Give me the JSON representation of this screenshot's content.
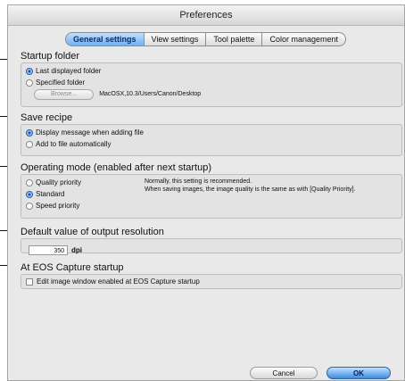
{
  "window": {
    "title": "Preferences"
  },
  "tabs": [
    {
      "label": "General settings"
    },
    {
      "label": "View settings"
    },
    {
      "label": "Tool palette"
    },
    {
      "label": "Color management"
    }
  ],
  "startup_folder": {
    "heading": "Startup folder",
    "options": [
      {
        "label": "Last displayed folder",
        "selected": true
      },
      {
        "label": "Specified folder",
        "selected": false
      }
    ],
    "browse_label": "Browse...",
    "path": "MacOSX,10.3/Users/Canon/Desktop"
  },
  "save_recipe": {
    "heading": "Save recipe",
    "options": [
      {
        "label": "Display message when adding file",
        "selected": true
      },
      {
        "label": "Add to file automatically",
        "selected": false
      }
    ]
  },
  "operating_mode": {
    "heading": "Operating mode (enabled after next startup)",
    "options": [
      {
        "label": "Quality priority",
        "selected": false
      },
      {
        "label": "Standard",
        "selected": true
      },
      {
        "label": "Speed priority",
        "selected": false
      }
    ],
    "note_line1": "Normally, this setting is recommended.",
    "note_line2": "When saving images, the image quality is the same as with [Quality Priority]."
  },
  "output_resolution": {
    "heading": "Default value of output resolution",
    "value": "350",
    "unit": "dpi"
  },
  "eos_capture": {
    "heading": "At EOS Capture startup",
    "checkbox_label": "Edit image window enabled at EOS Capture startup",
    "checked": false
  },
  "buttons": {
    "cancel": "Cancel",
    "ok": "OK"
  }
}
